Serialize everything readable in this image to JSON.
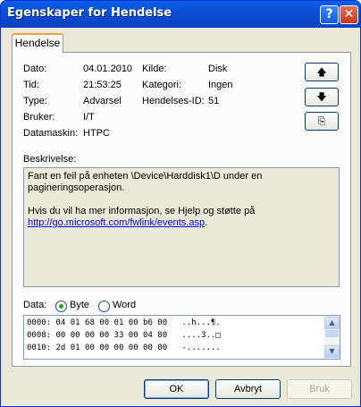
{
  "window": {
    "title": "Egenskaper for Hendelse",
    "help_label": "?",
    "close_label": "✕"
  },
  "tabs": [
    {
      "label": "Hendelse"
    }
  ],
  "fields": {
    "date_label": "Dato:",
    "date": "04.01.2010",
    "source_label": "Kilde:",
    "source": "Disk",
    "time_label": "Tid:",
    "time": "21:53:25",
    "category_label": "Kategori:",
    "category": "Ingen",
    "type_label": "Type:",
    "type": "Advarsel",
    "event_id_label": "Hendelses-ID:",
    "event_id": "51",
    "user_label": "Bruker:",
    "user": "I/T",
    "computer_label": "Datamaskin:",
    "computer": "HTPC"
  },
  "side_buttons": {
    "up": "🡅",
    "down": "🡇",
    "copy": "⎘"
  },
  "description": {
    "label": "Beskrivelse:",
    "line1": "Fant en feil på enheten \\Device\\Harddisk1\\D under en",
    "line2": "pagineringsoperasjon.",
    "line3": "Hvis du vil ha mer informasjon, se Hjelp og støtte på",
    "link": "http://go.microsoft.com/fwlink/events.asp",
    "link_suffix": "."
  },
  "data_section": {
    "label": "Data:",
    "options": [
      {
        "label": "Byte",
        "selected": true
      },
      {
        "label": "Word",
        "selected": false
      }
    ],
    "lines": [
      "0000: 04 01 68 00 01 00 b6 00   ..h...¶.",
      "0008: 00 00 00 00 33 00 04 80   ....3..□",
      "0010: 2d 01 00 00 00 00 00 00   -......."
    ]
  },
  "buttons": {
    "ok": "OK",
    "cancel": "Avbryt",
    "apply": "Bruk"
  },
  "icons": {
    "scroll_up": "▲",
    "scroll_down": "▼"
  }
}
